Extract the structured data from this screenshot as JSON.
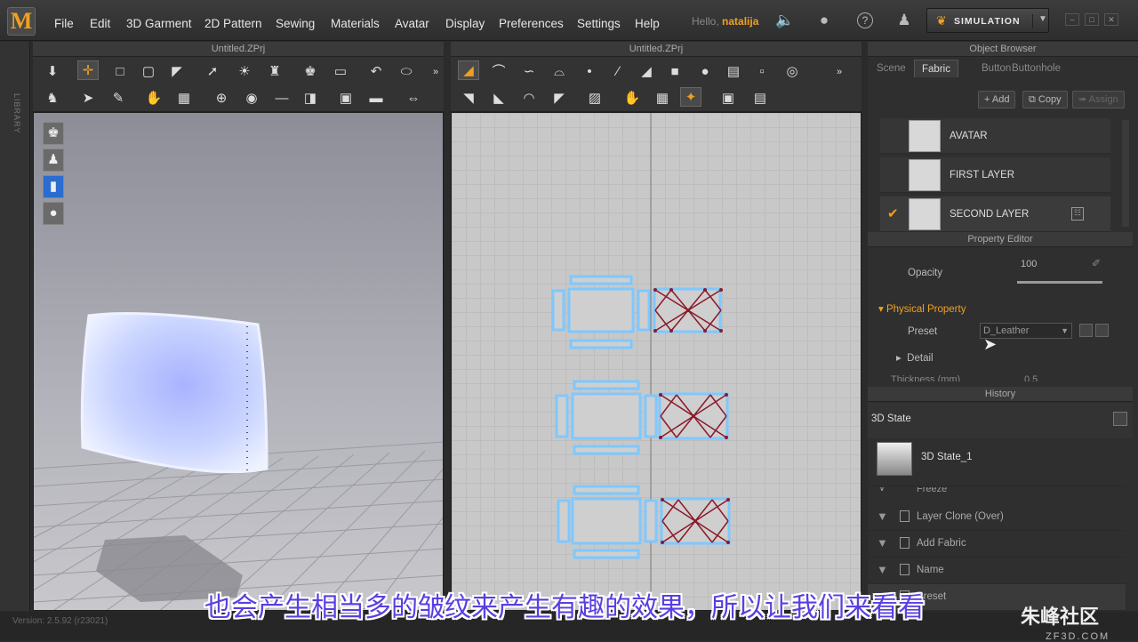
{
  "app": {
    "logo": "M"
  },
  "menu": [
    "File",
    "Edit",
    "3D Garment",
    "2D Pattern",
    "Sewing",
    "Materials",
    "Avatar",
    "Display",
    "Preferences",
    "Settings",
    "Help"
  ],
  "user": {
    "greeting": "Hello,",
    "name": "natalija"
  },
  "simulation_label": "SIMULATION",
  "library_label": "LIBRARY",
  "view3d": {
    "title": "Untitled.ZPrj"
  },
  "view2d": {
    "title": "Untitled.ZPrj"
  },
  "object_browser": {
    "title": "Object Browser",
    "tabs": [
      "Scene",
      "Fabric",
      "Button",
      "Buttonhole"
    ],
    "active_tab": "Fabric",
    "buttons": {
      "add": "Add",
      "copy": "Copy",
      "assign": "Assign"
    },
    "fabrics": [
      "AVATAR",
      "FIRST LAYER",
      "SECOND LAYER"
    ],
    "selected_fabric": "SECOND LAYER"
  },
  "property_editor": {
    "title": "Property Editor",
    "opacity_label": "Opacity",
    "opacity_value": "100",
    "opacity_level": 1.0,
    "physical_property": "Physical Property",
    "preset_label": "Preset",
    "preset_value": "D_Leather",
    "detail_label": "Detail",
    "thickness_label": "Thickness (mm)",
    "thickness_value": "0.5"
  },
  "history": {
    "title": "History",
    "state_title": "3D State",
    "state_item": "3D State_1",
    "items": [
      "Freeze",
      "Layer Clone (Over)",
      "Add Fabric",
      "Name",
      "Preset"
    ]
  },
  "status": {
    "version": "Version: 2.5.92    (r23021)"
  },
  "subtitle": "也会产生相当多的皱纹来产生有趣的效果，所以让我们来看看",
  "watermark": {
    "brand": "朱峰社区",
    "site": "ZF3D.COM"
  },
  "colors": {
    "accent": "#f0a020",
    "selection": "#6ec6ff",
    "internal_lines": "#8b1a2a",
    "subtitle": "#5a3fe0"
  },
  "icons": {
    "speaker": "speaker-icon",
    "user": "user-icon",
    "help": "help-icon"
  }
}
